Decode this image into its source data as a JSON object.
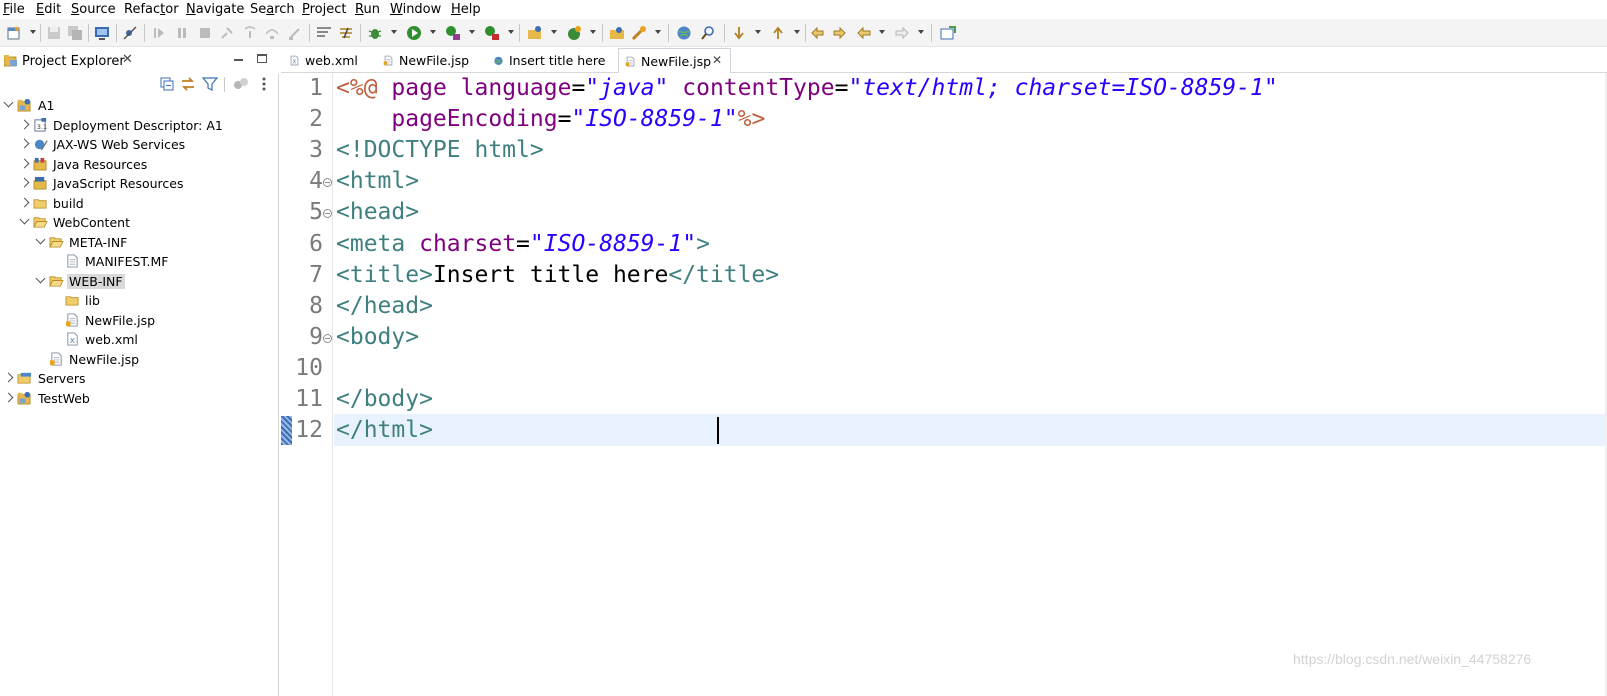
{
  "menu": [
    {
      "id": "file",
      "ul": "F",
      "rest": "ile"
    },
    {
      "id": "edit",
      "ul": "E",
      "rest": "dit"
    },
    {
      "id": "source",
      "ul": "S",
      "rest": "ource"
    },
    {
      "id": "refactor",
      "pre": "Refac",
      "ul": "t",
      "rest": "or"
    },
    {
      "id": "navigate",
      "ul": "N",
      "rest": "avigate"
    },
    {
      "id": "search",
      "pre": "Se",
      "ul": "a",
      "rest": "rch"
    },
    {
      "id": "project",
      "ul": "P",
      "rest": "roject"
    },
    {
      "id": "run",
      "ul": "R",
      "rest": "un"
    },
    {
      "id": "window",
      "ul": "W",
      "rest": "indow"
    },
    {
      "id": "help",
      "ul": "H",
      "rest": "elp"
    }
  ],
  "explorer": {
    "title": "Project Explorer",
    "close_glyph": "✕",
    "tree": [
      {
        "label": "A1",
        "icon": "project-icon"
      },
      {
        "label": "Deployment Descriptor: A1",
        "icon": "deployment-descriptor-icon"
      },
      {
        "label": "JAX-WS Web Services",
        "icon": "web-services-icon"
      },
      {
        "label": "Java Resources",
        "icon": "java-resources-icon"
      },
      {
        "label": "JavaScript Resources",
        "icon": "javascript-resources-icon"
      },
      {
        "label": "build",
        "icon": "folder-icon"
      },
      {
        "label": "WebContent",
        "icon": "folder-open-icon"
      },
      {
        "label": "META-INF",
        "icon": "folder-open-icon"
      },
      {
        "label": "MANIFEST.MF",
        "icon": "file-icon"
      },
      {
        "label": "WEB-INF",
        "icon": "folder-open-icon"
      },
      {
        "label": "lib",
        "icon": "folder-icon"
      },
      {
        "label": "NewFile.jsp",
        "icon": "jsp-file-icon"
      },
      {
        "label": "web.xml",
        "icon": "xml-file-icon"
      },
      {
        "label": "NewFile.jsp",
        "icon": "jsp-file-icon"
      },
      {
        "label": "Servers",
        "icon": "servers-icon"
      },
      {
        "label": "TestWeb",
        "icon": "project-icon"
      }
    ]
  },
  "editor": {
    "tabs": [
      {
        "label": "web.xml",
        "icon": "xml-file-icon",
        "active": false
      },
      {
        "label": "NewFile.jsp",
        "icon": "jsp-file-icon",
        "active": false
      },
      {
        "label": "Insert title here",
        "icon": "globe-icon",
        "active": false
      },
      {
        "label": "NewFile.jsp",
        "icon": "jsp-file-icon",
        "active": true,
        "close_glyph": "✕"
      }
    ],
    "line_numbers": [
      "1",
      "2",
      "3",
      "4",
      "5",
      "6",
      "7",
      "8",
      "9",
      "10",
      "11",
      "12"
    ],
    "lines": [
      [
        [
          "dir",
          "<%@"
        ],
        [
          "txt",
          " "
        ],
        [
          "attr",
          "page"
        ],
        [
          "txt",
          " "
        ],
        [
          "attr",
          "language"
        ],
        [
          "eq",
          "="
        ],
        [
          "str",
          "\"java\""
        ],
        [
          "txt",
          " "
        ],
        [
          "attr",
          "contentType"
        ],
        [
          "eq",
          "="
        ],
        [
          "str",
          "\"text/html; charset=ISO-8859-1\""
        ]
      ],
      [
        [
          "txt",
          "    "
        ],
        [
          "attr",
          "pageEncoding"
        ],
        [
          "eq",
          "="
        ],
        [
          "str",
          "\"ISO-8859-1\""
        ],
        [
          "dir",
          "%>"
        ]
      ],
      [
        [
          "tag",
          "<!DOCTYPE html>"
        ]
      ],
      [
        [
          "tag",
          "<html>"
        ]
      ],
      [
        [
          "tag",
          "<head>"
        ]
      ],
      [
        [
          "tag",
          "<meta"
        ],
        [
          "txt",
          " "
        ],
        [
          "attr",
          "charset"
        ],
        [
          "eq",
          "="
        ],
        [
          "str",
          "\"ISO-8859-1\""
        ],
        [
          "tag",
          ">"
        ]
      ],
      [
        [
          "tag",
          "<title>"
        ],
        [
          "txt",
          "Insert title here"
        ],
        [
          "tag",
          "</title>"
        ]
      ],
      [
        [
          "tag",
          "</head>"
        ]
      ],
      [
        [
          "tag",
          "<body>"
        ]
      ],
      [],
      [
        [
          "tag",
          "</body>"
        ]
      ],
      [
        [
          "tag",
          "</html>"
        ]
      ]
    ]
  },
  "watermark": "https://blog.csdn.net/weixin_44758276",
  "colors": {
    "directive": "#bf5f3f",
    "attribute": "#7f007f",
    "string": "#2a00ff",
    "tag": "#3f7f7f",
    "current_line": "#e8f2fe"
  }
}
